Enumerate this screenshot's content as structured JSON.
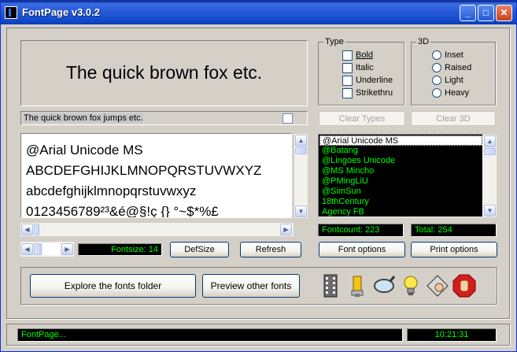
{
  "window": {
    "title": "FontPage v3.0.2",
    "controls": {
      "minimize": "_",
      "maximize": "□",
      "close": "✕"
    }
  },
  "preview": {
    "big_text": "The quick brown fox etc.",
    "small_text": "The quick brown fox jumps etc.",
    "sample_lines": [
      "@Arial Unicode MS",
      "ABCDEFGHIJKLMNOPQRSTUVWXYZ",
      "abcdefghijklmnopqrstuvwxyz",
      "0123456789²³&é@§!ç {}  °~$*%£"
    ]
  },
  "type_group": {
    "title": "Type",
    "options": [
      "Bold",
      "Italic",
      "Underline",
      "Strikethru"
    ]
  },
  "d3_group": {
    "title": "3D",
    "options": [
      "Inset",
      "Raised",
      "Light",
      "Heavy"
    ]
  },
  "buttons": {
    "clear_types": "Clear Types",
    "clear_3d": "Clear 3D",
    "defsize": "DefSize",
    "refresh": "Refresh",
    "font_options": "Font options",
    "print_options": "Print options",
    "explore": "Explore the fonts folder",
    "preview_other": "Preview other fonts"
  },
  "fontsize_label": "Fontsize: 14",
  "font_list": [
    "@Arial Unicode MS",
    "@Batang",
    "@Lingoes Unicode",
    "@MS Mincho",
    "@PMingLiU",
    "@SimSun",
    "18thCentury",
    "Agency FB"
  ],
  "fontcount": "Fontcount: 223",
  "total": "Total: 254",
  "status": {
    "text": "FontPage...",
    "time": "10:21:31"
  },
  "tools": [
    "film-icon",
    "usb-stick-icon",
    "magnifier-icon",
    "lightbulb-icon",
    "diamond-hand-icon",
    "stop-hand-icon"
  ],
  "colors": {
    "lcd_bg": "#000000",
    "lcd_fg": "#00ff00",
    "title_bar": "#0d47c9",
    "window_bg": "#d4d0c8"
  }
}
